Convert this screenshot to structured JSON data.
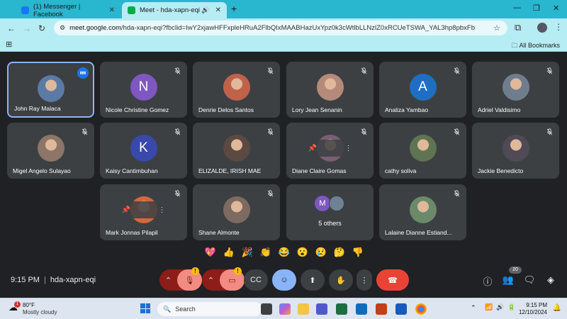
{
  "browser": {
    "tabs": [
      {
        "label": "(1) Messenger | Facebook",
        "active": false,
        "favicon_color": "#1877f2"
      },
      {
        "label": "Meet - hda-xapn-eqi",
        "active": true,
        "favicon_color": "#00ac47"
      }
    ],
    "url_domain": "meet.google.com",
    "url_path": "/hda-xapn-eqi?fbclid=IwY2xjawHFFxpleHRuA2FlbQIxMAABHazUxYpz0k3cWtlbLLNzlZ0xRCUeTSWA_YAL3hp8pbxFbIYTXYQAivKK1w_a...",
    "bookmarks_label": "All Bookmarks"
  },
  "meeting": {
    "code": "hda-xapn-eqi",
    "time": "9:15 PM",
    "participant_count": "20",
    "others_label": "5 others"
  },
  "participants": [
    {
      "name": "John Ray Malaca",
      "avatar": "photo",
      "color": "#5b7aa5",
      "speaking": true
    },
    {
      "name": "Nicole Christine Gomez",
      "avatar": "N",
      "color": "#7e57c2"
    },
    {
      "name": "Denrie Delos Santos",
      "avatar": "photo",
      "color": "#c0624a"
    },
    {
      "name": "Lory Jean Senanin",
      "avatar": "photo",
      "color": "#b58a7a"
    },
    {
      "name": "Analiza Yambao",
      "avatar": "A",
      "color": "#1e6fc4"
    },
    {
      "name": "Adriel Valdisimo",
      "avatar": "photo",
      "color": "#6f7d8c"
    },
    {
      "name": "Migel Angelo Sulayao",
      "avatar": "photo",
      "color": "#8d7667"
    },
    {
      "name": "Kaisy Cantimbuhan",
      "avatar": "K",
      "color": "#3949ab"
    },
    {
      "name": "ELIZALDE, IRISH MAE",
      "avatar": "photo",
      "color": "#5a4a42"
    },
    {
      "name": "Diane Claire Gomas",
      "avatar": "photo",
      "color": "#7a5f74"
    },
    {
      "name": "cathy soliva",
      "avatar": "photo",
      "color": "#5f7452"
    },
    {
      "name": "Jackie Benedicto",
      "avatar": "photo",
      "color": "#4f4a55"
    },
    {
      "name": "Mark Jonnas Pilapil",
      "avatar": "photo",
      "color": "#d2693d"
    },
    {
      "name": "Shane Almonte",
      "avatar": "photo",
      "color": "#7d6a60"
    },
    {
      "name": "Lalaine Dianne Estiand...",
      "avatar": "photo",
      "color": "#6b8a6a"
    }
  ],
  "reactions": [
    "💖",
    "👍",
    "🎉",
    "👏",
    "😂",
    "😮",
    "😢",
    "🤔",
    "👎"
  ],
  "taskbar": {
    "temperature": "80°F",
    "weather_text": "Mostly cloudy",
    "weather_badge": "1",
    "search_label": "Search",
    "clock_time": "9:15 PM",
    "clock_date": "12/10/2024"
  }
}
